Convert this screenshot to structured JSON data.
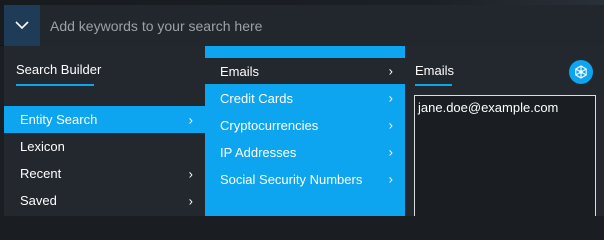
{
  "search": {
    "placeholder": "Add keywords to your search here",
    "dropdown_icon": "chevron-down-icon"
  },
  "builder": {
    "title": "Search Builder",
    "items": [
      {
        "label": "Entity Search",
        "has_submenu": true,
        "active": true
      },
      {
        "label": "Lexicon",
        "has_submenu": false,
        "active": false
      },
      {
        "label": "Recent",
        "has_submenu": true,
        "active": false
      },
      {
        "label": "Saved",
        "has_submenu": true,
        "active": false
      }
    ]
  },
  "entities": {
    "items": [
      {
        "label": "Emails",
        "has_submenu": true,
        "selected": true
      },
      {
        "label": "Credit Cards",
        "has_submenu": true
      },
      {
        "label": "Cryptocurrencies",
        "has_submenu": true
      },
      {
        "label": "IP Addresses",
        "has_submenu": true
      },
      {
        "label": "Social Security Numbers",
        "has_submenu": true
      }
    ]
  },
  "detail": {
    "title": "Emails",
    "settings_icon": "network-settings-icon",
    "value": "jane.doe@example.com"
  },
  "chevron_glyph": "›",
  "colors": {
    "accent": "#0ea5f0",
    "panel_bg": "#23272e",
    "input_bg": "#1a1d22",
    "top_bar_bg": "#14181d",
    "dropdown_bg": "#1e3b57"
  }
}
